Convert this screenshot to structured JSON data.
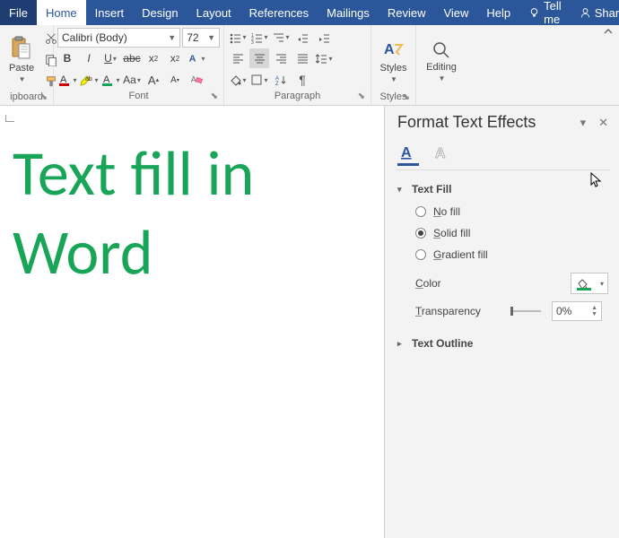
{
  "tabs": {
    "file": "File",
    "home": "Home",
    "insert": "Insert",
    "design": "Design",
    "layout": "Layout",
    "references": "References",
    "mailings": "Mailings",
    "review": "Review",
    "view": "View",
    "help": "Help",
    "tellme": "Tell me",
    "share": "Share"
  },
  "ribbon": {
    "clipboard": {
      "paste": "Paste",
      "label": "ipboard"
    },
    "font": {
      "name": "Calibri (Body)",
      "size": "72",
      "label": "Font"
    },
    "paragraph": {
      "label": "Paragraph"
    },
    "styles": {
      "btn": "Styles",
      "label": "Styles"
    },
    "editing": {
      "btn": "Editing"
    }
  },
  "document": {
    "text": "Text fill in Word",
    "text_color": "#18a558"
  },
  "pane": {
    "title": "Format Text Effects",
    "text_fill": {
      "header": "Text Fill",
      "no_fill": "No fill",
      "solid_fill": "Solid fill",
      "gradient_fill": "Gradient fill",
      "selected": "solid",
      "color_label": "Color",
      "transparency_label": "Transparency",
      "transparency_value": "0%"
    },
    "text_outline": {
      "header": "Text Outline"
    }
  }
}
